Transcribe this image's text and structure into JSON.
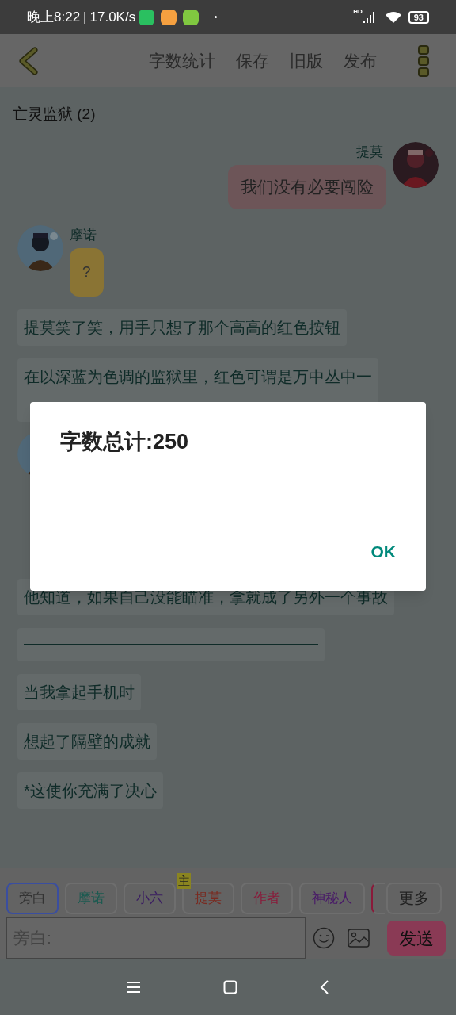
{
  "status_bar": {
    "time": "晚上8:22",
    "separator": "|",
    "speed": "17.0K/s",
    "hd_label": "HD",
    "battery": "93"
  },
  "toolbar": {
    "actions": [
      "字数统计",
      "保存",
      "旧版",
      "发布"
    ]
  },
  "chat": {
    "title": "亡灵监狱 (2)",
    "messages": [
      {
        "kind": "right",
        "name": "提莫",
        "text": "我们没有必要闯险",
        "color": "#6d5558"
      },
      {
        "kind": "left",
        "name": "摩诺",
        "text": "?",
        "color": "#8a7434"
      },
      {
        "kind": "narration",
        "text": "提莫笑了笑，用手只想了那个高高的红色按钮"
      },
      {
        "kind": "narration_tall",
        "text": "在以深蓝为色调的监狱里，红色可谓是万中丛中一"
      },
      {
        "kind": "avatar_only"
      },
      {
        "kind": "narration",
        "text": "他知道，如果自己没能瞄准，拿就成了另外一个事故"
      },
      {
        "kind": "divider"
      },
      {
        "kind": "narration",
        "text": "当我拿起手机时"
      },
      {
        "kind": "narration",
        "text": "想起了隔壁的成就"
      },
      {
        "kind": "narration",
        "text": "*这使你充满了决心"
      }
    ]
  },
  "roles": [
    {
      "label": "旁白",
      "color": "#333333",
      "selected": true
    },
    {
      "label": "摩诺",
      "color": "#1a5a50",
      "selected": false
    },
    {
      "label": "小六",
      "color": "#3a1c62",
      "selected": false
    },
    {
      "label": "提莫",
      "color": "#7a2a20",
      "selected": false,
      "badge": "主"
    },
    {
      "label": "作者",
      "color": "#8a1a3a",
      "selected": false
    },
    {
      "label": "神秘人",
      "color": "#481868",
      "selected": false
    },
    {
      "kind": "partial",
      "color": "#8a1a3a",
      "selected": false
    }
  ],
  "more_button": "更多",
  "input": {
    "placeholder": "旁白:"
  },
  "send_button": "发送",
  "dialog": {
    "title": "字数总计:250",
    "button": "OK"
  }
}
